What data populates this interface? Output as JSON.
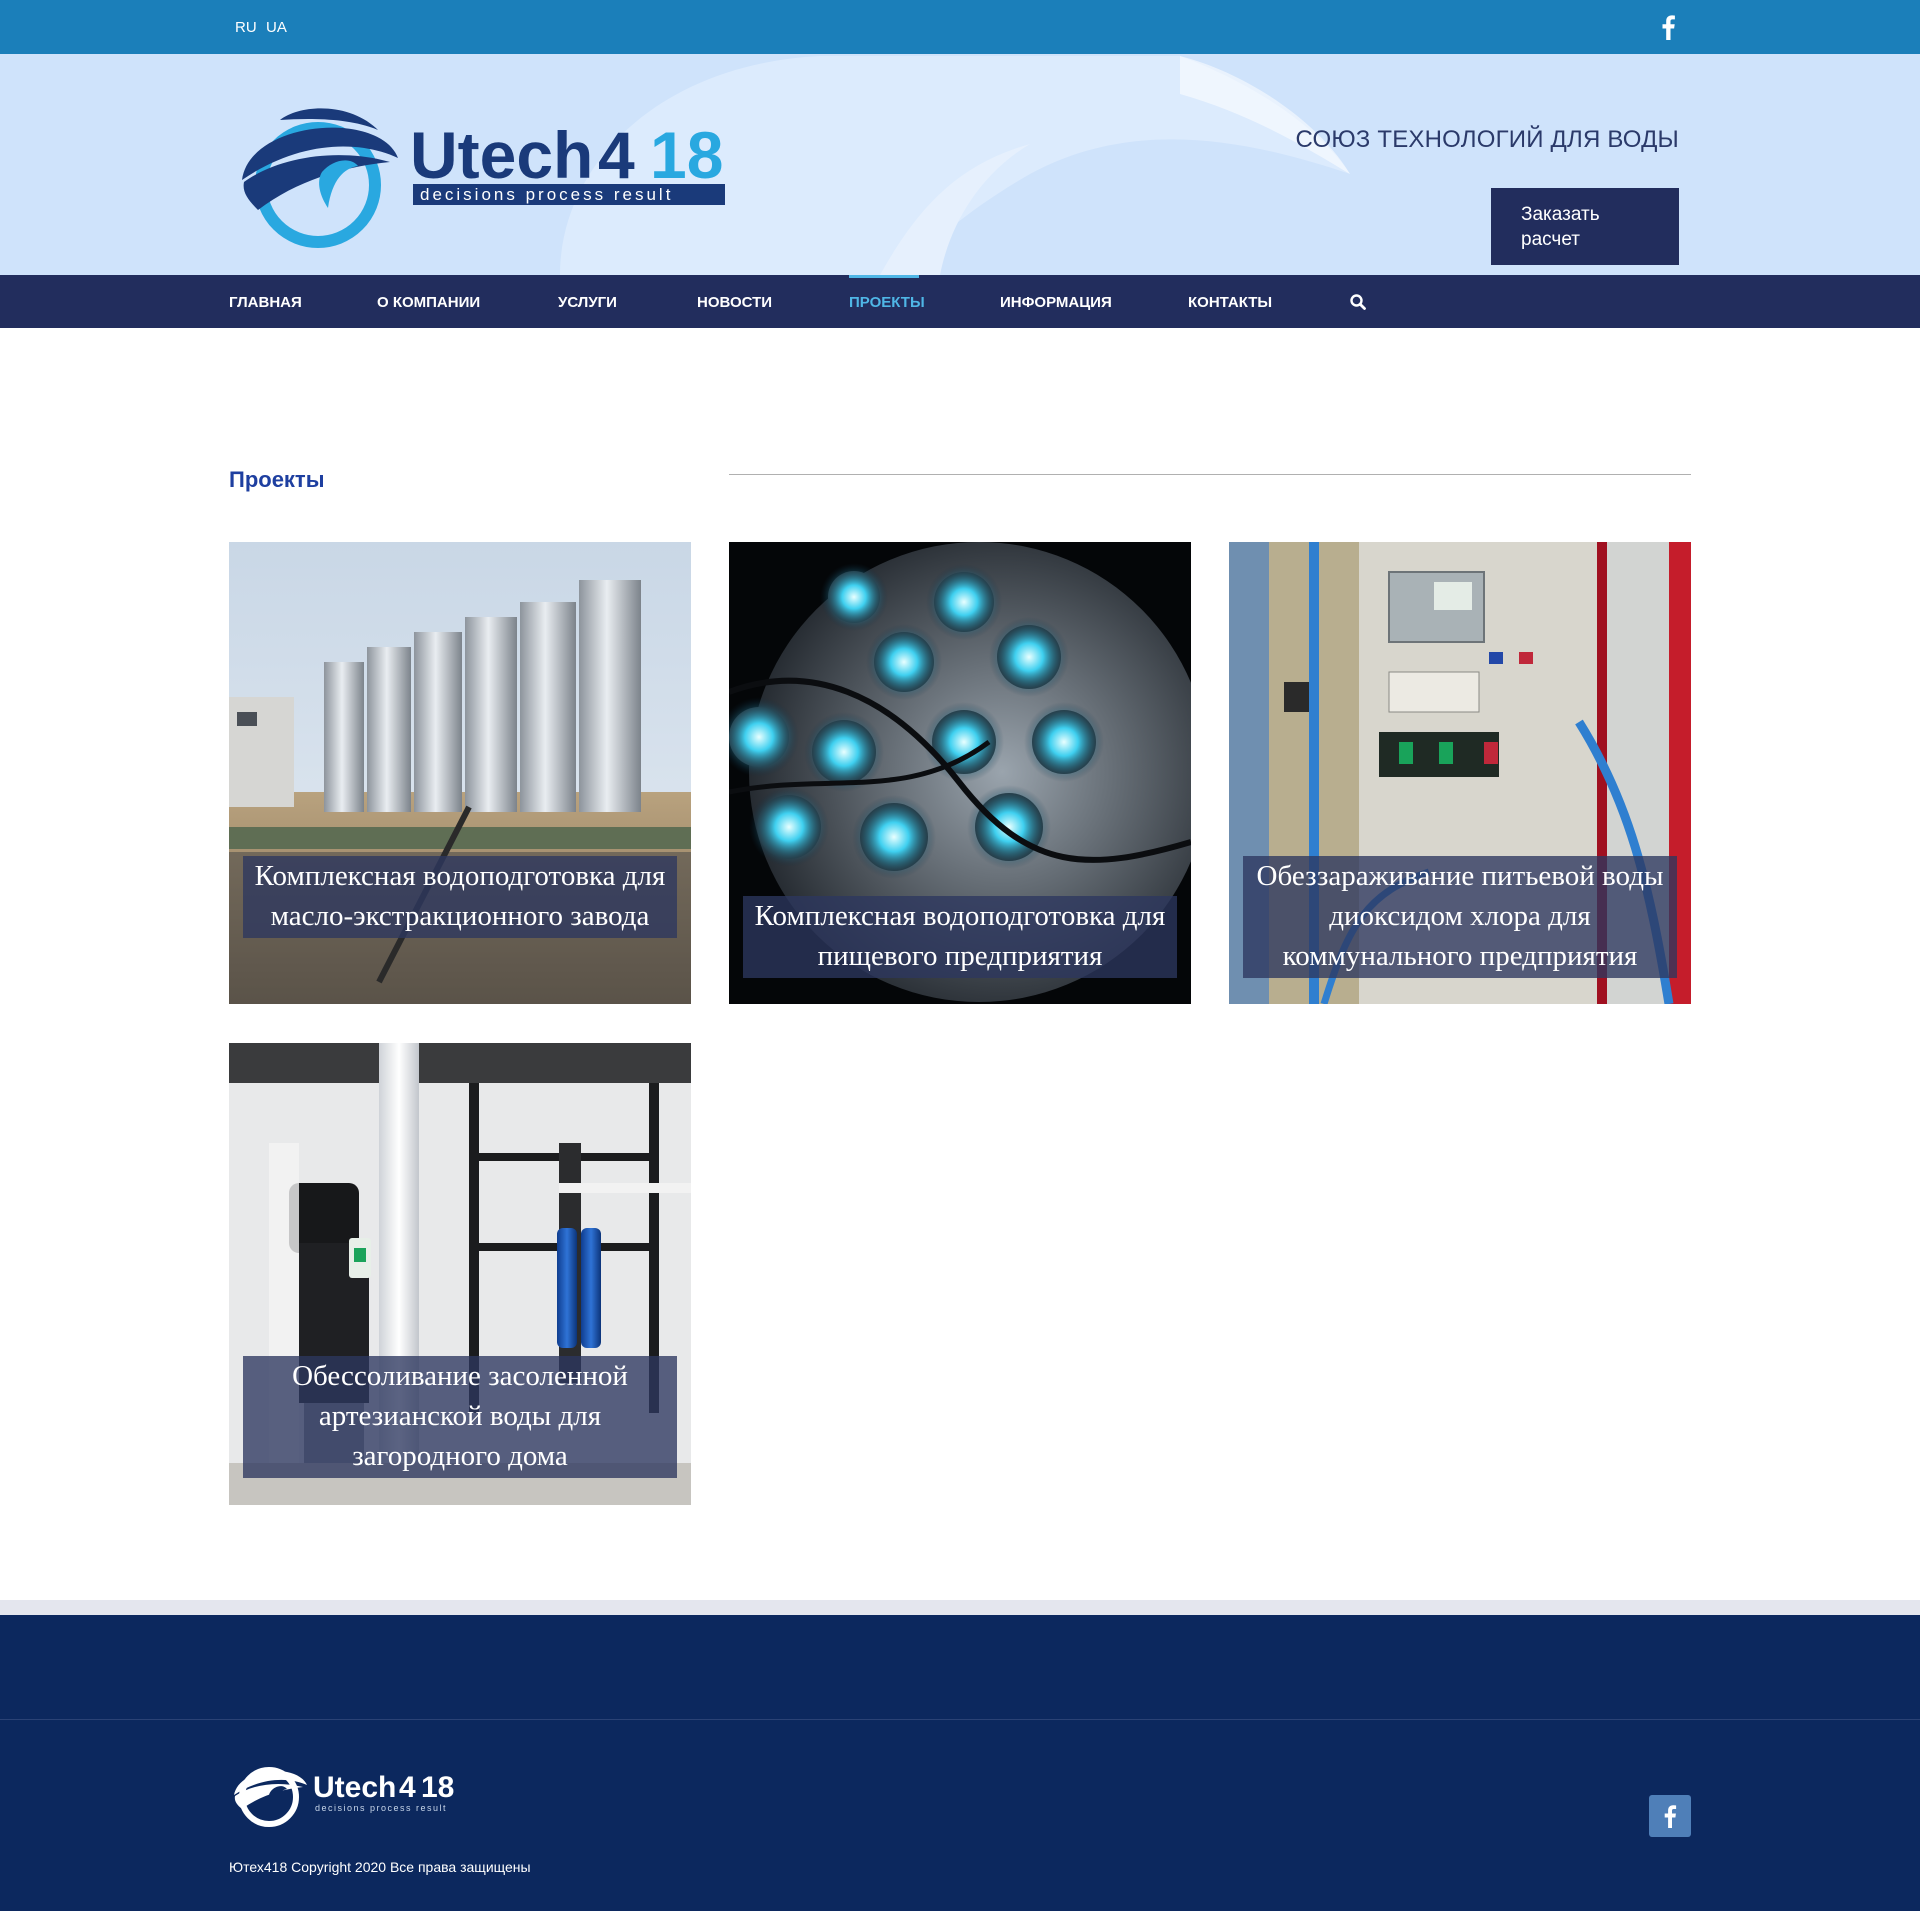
{
  "topbar": {
    "languages": [
      "RU",
      "UA"
    ],
    "social_icon": "facebook-icon"
  },
  "header": {
    "logo_text": "Utech",
    "logo_number_a": "4",
    "logo_number_b": "18",
    "logo_slogan": "decisions process result",
    "tagline": "СОЮЗ ТЕХНОЛОГИЙ ДЛЯ ВОДЫ",
    "order_button": "Заказать расчет"
  },
  "nav": {
    "items": [
      "ГЛАВНАЯ",
      "О КОМПАНИИ",
      "УСЛУГИ",
      "НОВОСТИ",
      "ПРОЕКТЫ",
      "ИНФОРМАЦИЯ",
      "КОНТАКТЫ"
    ],
    "active": "ПРОЕКТЫ",
    "search_icon": "search-icon"
  },
  "main": {
    "section_title": "Проекты",
    "projects": [
      {
        "title": "Комплексная водоподготовка для масло-экстракционного завода"
      },
      {
        "title": "Комплексная водоподготовка для пищевого предприятия"
      },
      {
        "title": "Обеззараживание питьевой воды диоксидом хлора для коммунального предприятия"
      },
      {
        "title": "Обессоливание засоленной артезианской воды для загородного дома"
      }
    ]
  },
  "footer": {
    "logo_text": "Utech",
    "logo_number_a": "4",
    "logo_number_b": "18",
    "logo_slogan": "decisions process result",
    "copyright": "Ютех418 Copyright 2020 Все права защищены",
    "social_icon": "facebook-icon"
  },
  "colors": {
    "topbar": "#1b7fba",
    "header_bg": "#cfe3fb",
    "nav_bg": "#222d5d",
    "nav_active": "#4fb6e6",
    "title": "#1e3fa0",
    "footer_bg": "#0c285e"
  }
}
